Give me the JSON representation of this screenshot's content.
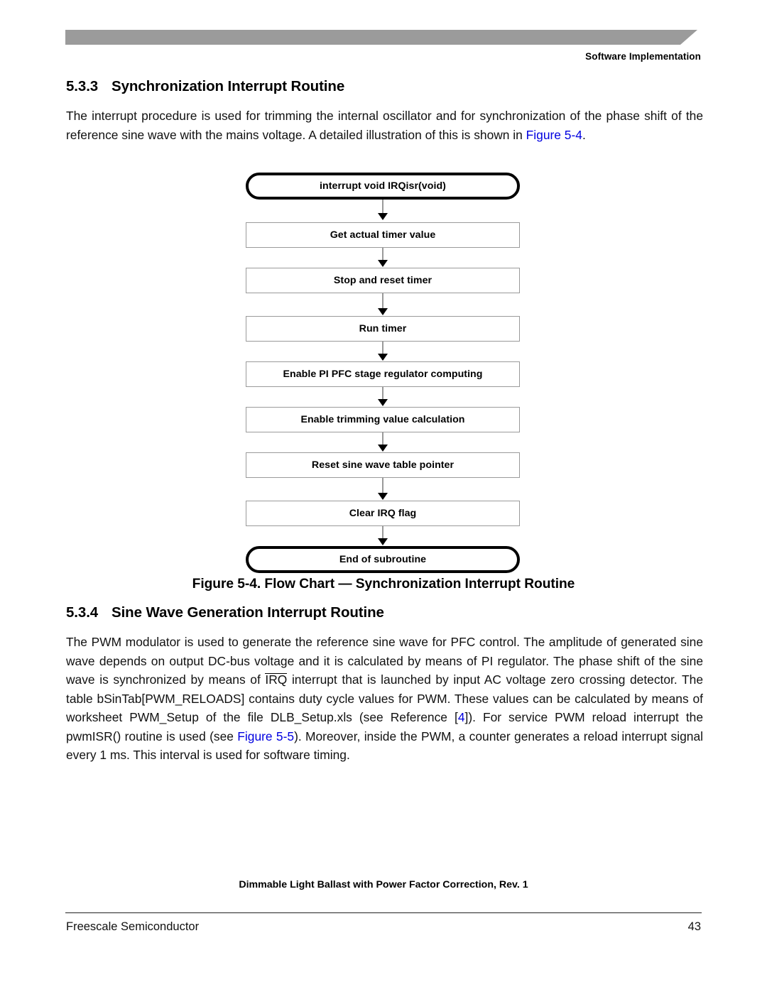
{
  "header": {
    "running_head": "Software Implementation",
    "banner_color": "#9b9b9b"
  },
  "sections": [
    {
      "number": "5.3.3",
      "title": "Synchronization Interrupt Routine"
    },
    {
      "number": "5.3.4",
      "title": "Sine Wave Generation Interrupt Routine"
    }
  ],
  "paragraphs": {
    "p1": {
      "part1": "The interrupt procedure is used for trimming the internal oscillator and for synchronization of the phase shift of the reference sine wave with the mains voltage. A detailed illustration of this is shown in ",
      "link1": "Figure 5-4",
      "part2": "."
    },
    "p2": {
      "part1": "The PWM modulator is used to generate the reference sine wave for PFC control. The amplitude of generated sine wave depends on output DC-bus voltage and it is calculated by means of PI regulator. The phase shift of the sine wave is synchronized by means of ",
      "overline1": "IRQ",
      "part2": " interrupt that is launched by input AC voltage zero crossing detector. The table bSinTab[PWM_RELOADS] contains duty cycle values for PWM. These values can be calculated by means of worksheet PWM_Setup of the file DLB_Setup.xls (see Reference [",
      "link1": "4",
      "part3": "]). For service PWM reload interrupt the pwmISR() routine is used (see ",
      "link2": "Figure 5-5",
      "part4": "). Moreover, inside the PWM, a counter generates a reload interrupt signal every 1 ms. This interval is used for software timing."
    }
  },
  "flowchart": {
    "caption": "Figure 5-4. Flow Chart — Synchronization Interrupt Routine",
    "nodes": [
      {
        "label": "interrupt void IRQisr(void)",
        "type": "terminal"
      },
      {
        "label": "Get actual timer value",
        "type": "process"
      },
      {
        "label": "Stop and reset timer",
        "type": "process"
      },
      {
        "label": "Run timer",
        "type": "process"
      },
      {
        "label": "Enable PI PFC stage regulator computing",
        "type": "process"
      },
      {
        "label": "Enable trimming value calculation",
        "type": "process"
      },
      {
        "label": "Reset sine wave table pointer",
        "type": "process"
      },
      {
        "label": "Clear IRQ flag",
        "type": "process"
      },
      {
        "label": "End of subroutine",
        "type": "terminal"
      }
    ]
  },
  "footer": {
    "document_title": "Dimmable Light Ballast with Power Factor Correction, Rev. 1",
    "company": "Freescale Semiconductor",
    "page_number": "43"
  },
  "colors": {
    "link": "#0000E0",
    "banner": "#9b9b9b",
    "process_border": "#9a9a9a"
  }
}
